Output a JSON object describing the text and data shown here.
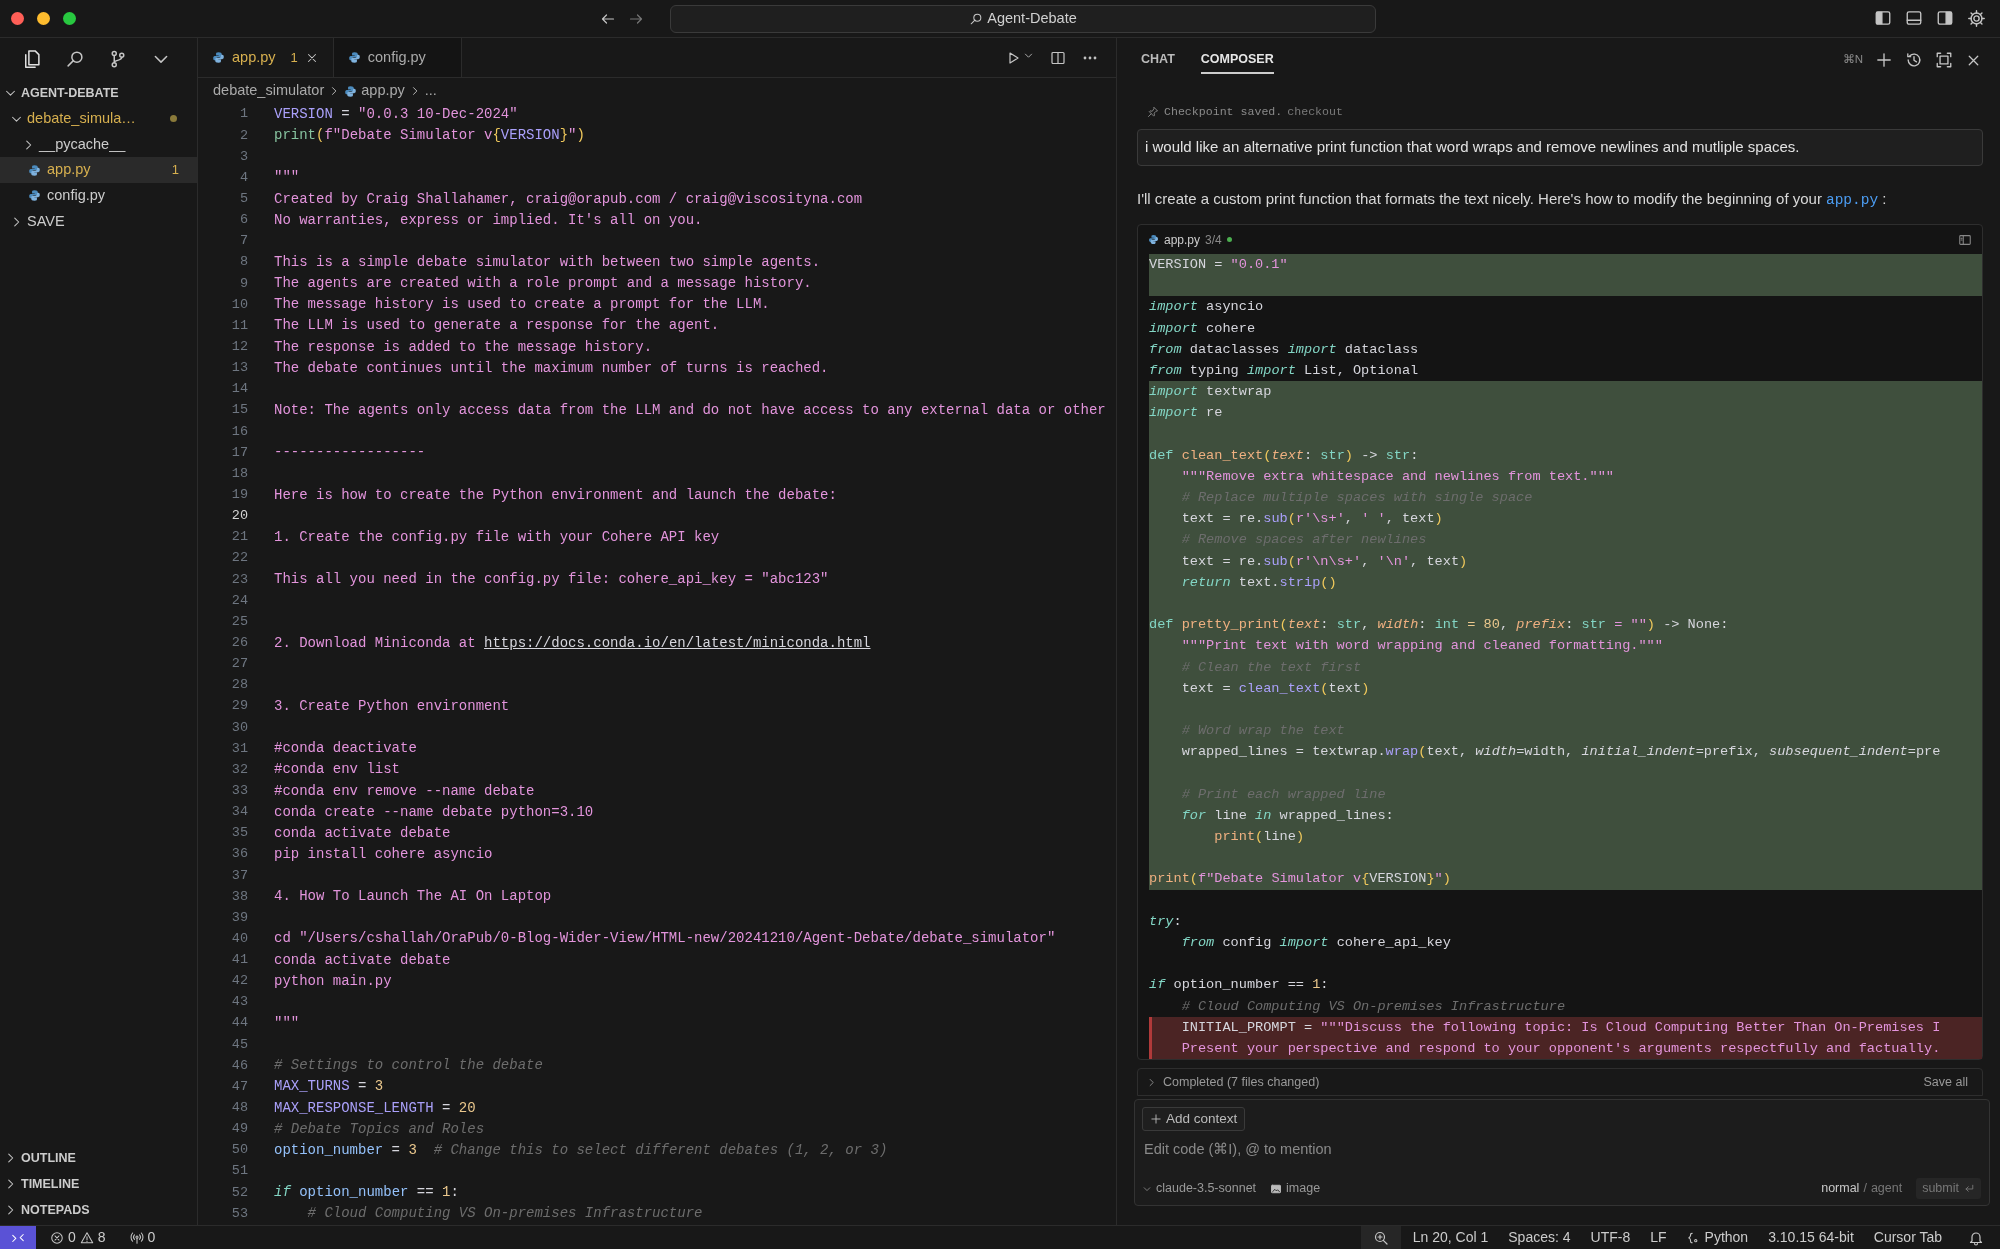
{
  "window": {
    "title": "Agent-Debate"
  },
  "explorer": {
    "title": "AGENT-DEBATE",
    "expanded": true,
    "items": [
      {
        "label": "debate_simula…",
        "kind": "folder",
        "expanded": true,
        "modified": true,
        "selected": false,
        "children": [
          {
            "label": "__pycache__",
            "kind": "folder",
            "expanded": false,
            "modified": false,
            "selected": false
          },
          {
            "label": "app.py",
            "kind": "file",
            "modified": false,
            "selected": true,
            "badge": "1"
          },
          {
            "label": "config.py",
            "kind": "file",
            "modified": false,
            "selected": false
          }
        ]
      },
      {
        "label": "SAVE",
        "kind": "folder",
        "expanded": false,
        "modified": false,
        "selected": false
      }
    ]
  },
  "panels": [
    {
      "label": "OUTLINE",
      "expanded": false
    },
    {
      "label": "TIMELINE",
      "expanded": false
    },
    {
      "label": "NOTEPADS",
      "expanded": false
    }
  ],
  "editor": {
    "tabs": [
      {
        "label": "app.py",
        "badge": "1",
        "selected": true
      },
      {
        "label": "config.py",
        "selected": false
      }
    ],
    "breadcrumb": [
      "debate_simulator",
      "app.py",
      "..."
    ],
    "lines": [
      {
        "n": "1",
        "current": false,
        "tokens": [
          {
            "kind": "variable",
            "text": "VERSION"
          },
          {
            "kind": "plain",
            "text": " = "
          },
          {
            "kind": "string",
            "text": "\"0.0.3 10-Dec-2024\""
          }
        ]
      },
      {
        "n": "2",
        "current": false,
        "tokens": [
          {
            "kind": "call",
            "text": "print"
          },
          {
            "kind": "bracket",
            "text": "("
          },
          {
            "kind": "string",
            "text": "f\"Debate Simulator v"
          },
          {
            "kind": "bracket",
            "text": "{"
          },
          {
            "kind": "variable",
            "text": "VERSION"
          },
          {
            "kind": "bracket",
            "text": "}"
          },
          {
            "kind": "string",
            "text": "\""
          },
          {
            "kind": "bracket",
            "text": ")"
          }
        ]
      },
      {
        "n": "3",
        "current": false
      },
      {
        "n": "4",
        "current": false,
        "tokens": [
          {
            "kind": "string",
            "text": "\"\"\""
          }
        ]
      },
      {
        "n": "5",
        "current": false,
        "tokens": [
          {
            "kind": "string",
            "text": "Created by Craig Shallahamer, craig@orapub.com / craig@viscosityna.com"
          }
        ]
      },
      {
        "n": "6",
        "current": false,
        "tokens": [
          {
            "kind": "string",
            "text": "No warranties, express or implied. It's all on you."
          }
        ]
      },
      {
        "n": "7",
        "current": false
      },
      {
        "n": "8",
        "current": false,
        "tokens": [
          {
            "kind": "string",
            "text": "This is a simple debate simulator with between two simple agents."
          }
        ]
      },
      {
        "n": "9",
        "current": false,
        "tokens": [
          {
            "kind": "string",
            "text": "The agents are created with a role prompt and a message history."
          }
        ]
      },
      {
        "n": "10",
        "current": false,
        "tokens": [
          {
            "kind": "string",
            "text": "The message history is used to create a prompt for the LLM."
          }
        ]
      },
      {
        "n": "11",
        "current": false,
        "tokens": [
          {
            "kind": "string",
            "text": "The LLM is used to generate a response for the agent."
          }
        ]
      },
      {
        "n": "12",
        "current": false,
        "tokens": [
          {
            "kind": "string",
            "text": "The response is added to the message history."
          }
        ]
      },
      {
        "n": "13",
        "current": false,
        "tokens": [
          {
            "kind": "string",
            "text": "The debate continues until the maximum number of turns is reached."
          }
        ]
      },
      {
        "n": "14",
        "current": false
      },
      {
        "n": "15",
        "current": false,
        "tokens": [
          {
            "kind": "string",
            "text": "Note: The agents only access data from the LLM and do not have access to any external data or other"
          }
        ]
      },
      {
        "n": "16",
        "current": false
      },
      {
        "n": "17",
        "current": false,
        "tokens": [
          {
            "kind": "string",
            "text": "------------------"
          }
        ]
      },
      {
        "n": "18",
        "current": false
      },
      {
        "n": "19",
        "current": false,
        "tokens": [
          {
            "kind": "string",
            "text": "Here is how to create the Python environment and launch the debate:"
          }
        ]
      },
      {
        "n": "20",
        "current": true
      },
      {
        "n": "21",
        "current": false,
        "tokens": [
          {
            "kind": "string",
            "text": "1. Create the config.py file with your Cohere API key"
          }
        ]
      },
      {
        "n": "22",
        "current": false
      },
      {
        "n": "23",
        "current": false,
        "tokens": [
          {
            "kind": "string",
            "text": "This all you need in the config.py file: cohere_api_key = \"abc123\""
          }
        ]
      },
      {
        "n": "24",
        "current": false
      },
      {
        "n": "25",
        "current": false
      },
      {
        "n": "26",
        "current": false,
        "tokens": [
          {
            "kind": "string",
            "text": "2. Download Miniconda at "
          },
          {
            "kind": "link",
            "text": "https://docs.conda.io/en/latest/miniconda.html"
          }
        ]
      },
      {
        "n": "27",
        "current": false
      },
      {
        "n": "28",
        "current": false
      },
      {
        "n": "29",
        "current": false,
        "tokens": [
          {
            "kind": "string",
            "text": "3. Create Python environment"
          }
        ]
      },
      {
        "n": "30",
        "current": false
      },
      {
        "n": "31",
        "current": false,
        "tokens": [
          {
            "kind": "string",
            "text": "#conda deactivate"
          }
        ]
      },
      {
        "n": "32",
        "current": false,
        "tokens": [
          {
            "kind": "string",
            "text": "#conda env list"
          }
        ]
      },
      {
        "n": "33",
        "current": false,
        "tokens": [
          {
            "kind": "string",
            "text": "#conda env remove --name debate"
          }
        ]
      },
      {
        "n": "34",
        "current": false,
        "tokens": [
          {
            "kind": "string",
            "text": "conda create --name debate python=3.10"
          }
        ]
      },
      {
        "n": "35",
        "current": false,
        "tokens": [
          {
            "kind": "string",
            "text": "conda activate debate"
          }
        ]
      },
      {
        "n": "36",
        "current": false,
        "tokens": [
          {
            "kind": "string",
            "text": "pip install cohere asyncio"
          }
        ]
      },
      {
        "n": "37",
        "current": false
      },
      {
        "n": "38",
        "current": false,
        "tokens": [
          {
            "kind": "string",
            "text": "4. How To Launch The AI On Laptop"
          }
        ]
      },
      {
        "n": "39",
        "current": false
      },
      {
        "n": "40",
        "current": false,
        "tokens": [
          {
            "kind": "string",
            "text": "cd \"/Users/cshallah/OraPub/0-Blog-Wider-View/HTML-new/20241210/Agent-Debate/debate_simulator\""
          }
        ]
      },
      {
        "n": "41",
        "current": false,
        "tokens": [
          {
            "kind": "string",
            "text": "conda activate debate"
          }
        ]
      },
      {
        "n": "42",
        "current": false,
        "tokens": [
          {
            "kind": "string",
            "text": "python main.py"
          }
        ]
      },
      {
        "n": "43",
        "current": false
      },
      {
        "n": "44",
        "current": false,
        "tokens": [
          {
            "kind": "string",
            "text": "\"\"\""
          }
        ]
      },
      {
        "n": "45",
        "current": false
      },
      {
        "n": "46",
        "current": false,
        "tokens": [
          {
            "kind": "comment",
            "text": "# Settings to control the debate"
          }
        ]
      },
      {
        "n": "47",
        "current": false,
        "tokens": [
          {
            "kind": "variable",
            "text": "MAX_TURNS"
          },
          {
            "kind": "plain",
            "text": " = "
          },
          {
            "kind": "number",
            "text": "3"
          }
        ]
      },
      {
        "n": "48",
        "current": false,
        "tokens": [
          {
            "kind": "variable",
            "text": "MAX_RESPONSE_LENGTH"
          },
          {
            "kind": "plain",
            "text": " = "
          },
          {
            "kind": "number",
            "text": "20"
          }
        ]
      },
      {
        "n": "49",
        "current": false,
        "tokens": [
          {
            "kind": "comment",
            "text": "# Debate Topics and Roles"
          }
        ]
      },
      {
        "n": "50",
        "current": false,
        "tokens": [
          {
            "kind": "identifier",
            "text": "option_number"
          },
          {
            "kind": "plain",
            "text": " = "
          },
          {
            "kind": "number",
            "text": "3"
          },
          {
            "kind": "comment",
            "text": "  # Change this to select different debates (1, 2, or 3)"
          }
        ]
      },
      {
        "n": "51",
        "current": false
      },
      {
        "n": "52",
        "current": false,
        "tokens": [
          {
            "kind": "keyword",
            "text": "if"
          },
          {
            "kind": "identifier",
            "text": " option_number"
          },
          {
            "kind": "plain",
            "text": " == "
          },
          {
            "kind": "number",
            "text": "1"
          },
          {
            "kind": "plain",
            "text": ":"
          }
        ]
      },
      {
        "n": "53",
        "current": false,
        "tokens": [
          {
            "kind": "comment",
            "text": "    # Cloud Computing VS On-premises Infrastructure"
          }
        ]
      }
    ]
  },
  "composer": {
    "tabs": [
      {
        "label": "CHAT",
        "selected": false
      },
      {
        "label": "COMPOSER",
        "selected": true
      }
    ],
    "shortcut": "⌘N",
    "checkpoint": {
      "label": "Checkpoint saved.",
      "action": "checkout"
    },
    "user_message": "i would like an alternative print function that word wraps and remove newlines and mutliple spaces.",
    "reply": {
      "text": "I'll create a custom print function that formats the text nicely. Here's how to modify the beginning of your",
      "file_link": "app.py",
      "after": ":"
    },
    "code_block": {
      "file": "app.py",
      "progress": "3/4",
      "lines": [
        {
          "kind": "added",
          "tokens": [
            {
              "kind": "plain",
              "text": "VERSION = "
            },
            {
              "kind": "string",
              "text": "\"0.0.1\""
            }
          ]
        },
        {
          "kind": "added"
        },
        {
          "kind": "plain",
          "tokens": [
            {
              "kind": "keyword",
              "text": "import"
            },
            {
              "kind": "plain",
              "text": " asyncio"
            }
          ]
        },
        {
          "kind": "plain",
          "tokens": [
            {
              "kind": "keyword",
              "text": "import"
            },
            {
              "kind": "plain",
              "text": " cohere"
            }
          ]
        },
        {
          "kind": "plain",
          "tokens": [
            {
              "kind": "keyword",
              "text": "from"
            },
            {
              "kind": "plain",
              "text": " dataclasses "
            },
            {
              "kind": "keyword",
              "text": "import"
            },
            {
              "kind": "plain",
              "text": " dataclass"
            }
          ]
        },
        {
          "kind": "plain",
          "tokens": [
            {
              "kind": "keyword",
              "text": "from"
            },
            {
              "kind": "plain",
              "text": " typing "
            },
            {
              "kind": "keyword",
              "text": "import"
            },
            {
              "kind": "plain",
              "text": " List, Optional"
            }
          ]
        },
        {
          "kind": "added",
          "tokens": [
            {
              "kind": "keyword",
              "text": "import"
            },
            {
              "kind": "plain",
              "text": " textwrap"
            }
          ]
        },
        {
          "kind": "added",
          "tokens": [
            {
              "kind": "keyword",
              "text": "import"
            },
            {
              "kind": "plain",
              "text": " re"
            }
          ]
        },
        {
          "kind": "added"
        },
        {
          "kind": "added",
          "tokens": [
            {
              "kind": "builtin",
              "text": "def"
            },
            {
              "kind": "function",
              "text": " clean_text"
            },
            {
              "kind": "bracket",
              "text": "("
            },
            {
              "kind": "parameter",
              "text": "text"
            },
            {
              "kind": "plain",
              "text": ": "
            },
            {
              "kind": "builtin",
              "text": "str"
            },
            {
              "kind": "bracket",
              "text": ")"
            },
            {
              "kind": "plain",
              "text": " -> "
            },
            {
              "kind": "builtin",
              "text": "str"
            },
            {
              "kind": "plain",
              "text": ":"
            }
          ]
        },
        {
          "kind": "added",
          "tokens": [
            {
              "kind": "string",
              "text": "    \"\"\"Remove extra whitespace and newlines from text.\"\"\""
            }
          ]
        },
        {
          "kind": "added",
          "tokens": [
            {
              "kind": "comment",
              "text": "    # Replace multiple spaces with single space"
            }
          ]
        },
        {
          "kind": "added",
          "tokens": [
            {
              "kind": "plain",
              "text": "    text = re."
            },
            {
              "kind": "method",
              "text": "sub"
            },
            {
              "kind": "bracket",
              "text": "("
            },
            {
              "kind": "string",
              "text": "r'\\s+'"
            },
            {
              "kind": "plain",
              "text": ", "
            },
            {
              "kind": "string",
              "text": "' '"
            },
            {
              "kind": "plain",
              "text": ", text"
            },
            {
              "kind": "bracket",
              "text": ")"
            }
          ]
        },
        {
          "kind": "added",
          "tokens": [
            {
              "kind": "comment",
              "text": "    # Remove spaces after newlines"
            }
          ]
        },
        {
          "kind": "added",
          "tokens": [
            {
              "kind": "plain",
              "text": "    text = re."
            },
            {
              "kind": "method",
              "text": "sub"
            },
            {
              "kind": "bracket",
              "text": "("
            },
            {
              "kind": "string",
              "text": "r'\\n\\s+'"
            },
            {
              "kind": "plain",
              "text": ", "
            },
            {
              "kind": "string",
              "text": "'\\n'"
            },
            {
              "kind": "plain",
              "text": ", text"
            },
            {
              "kind": "bracket",
              "text": ")"
            }
          ]
        },
        {
          "kind": "added",
          "tokens": [
            {
              "kind": "keyword",
              "text": "    return"
            },
            {
              "kind": "plain",
              "text": " text."
            },
            {
              "kind": "method",
              "text": "strip"
            },
            {
              "kind": "bracket",
              "text": "()"
            }
          ]
        },
        {
          "kind": "added"
        },
        {
          "kind": "added",
          "tokens": [
            {
              "kind": "builtin",
              "text": "def"
            },
            {
              "kind": "function",
              "text": " pretty_print"
            },
            {
              "kind": "bracket",
              "text": "("
            },
            {
              "kind": "parameter",
              "text": "text"
            },
            {
              "kind": "plain",
              "text": ": "
            },
            {
              "kind": "builtin",
              "text": "str"
            },
            {
              "kind": "plain",
              "text": ", "
            },
            {
              "kind": "parameter",
              "text": "width"
            },
            {
              "kind": "plain",
              "text": ": "
            },
            {
              "kind": "builtin",
              "text": "int"
            },
            {
              "kind": "number",
              "text": " = 80"
            },
            {
              "kind": "plain",
              "text": ", "
            },
            {
              "kind": "parameter",
              "text": "prefix"
            },
            {
              "kind": "plain",
              "text": ": "
            },
            {
              "kind": "builtin",
              "text": "str"
            },
            {
              "kind": "string",
              "text": " = \"\""
            },
            {
              "kind": "bracket",
              "text": ")"
            },
            {
              "kind": "plain",
              "text": " -> None:"
            }
          ]
        },
        {
          "kind": "added",
          "tokens": [
            {
              "kind": "string",
              "text": "    \"\"\"Print text with word wrapping and cleaned formatting.\"\"\""
            }
          ]
        },
        {
          "kind": "added",
          "tokens": [
            {
              "kind": "comment",
              "text": "    # Clean the text first"
            }
          ]
        },
        {
          "kind": "added",
          "tokens": [
            {
              "kind": "plain",
              "text": "    text = "
            },
            {
              "kind": "method",
              "text": "clean_text"
            },
            {
              "kind": "bracket",
              "text": "("
            },
            {
              "kind": "plain",
              "text": "text"
            },
            {
              "kind": "bracket",
              "text": ")"
            }
          ]
        },
        {
          "kind": "added"
        },
        {
          "kind": "added",
          "tokens": [
            {
              "kind": "comment",
              "text": "    # Word wrap the text"
            }
          ]
        },
        {
          "kind": "added",
          "tokens": [
            {
              "kind": "plain",
              "text": "    wrapped_lines = textwrap."
            },
            {
              "kind": "method",
              "text": "wrap"
            },
            {
              "kind": "bracket",
              "text": "("
            },
            {
              "kind": "plain",
              "text": "text, "
            },
            {
              "kind": "argument",
              "text": "width"
            },
            {
              "kind": "plain",
              "text": "=width, "
            },
            {
              "kind": "argument",
              "text": "initial_indent"
            },
            {
              "kind": "plain",
              "text": "=prefix, "
            },
            {
              "kind": "argument",
              "text": "subsequent_indent"
            },
            {
              "kind": "plain",
              "text": "=pre"
            }
          ]
        },
        {
          "kind": "added"
        },
        {
          "kind": "added",
          "tokens": [
            {
              "kind": "comment",
              "text": "    # Print each wrapped line"
            }
          ]
        },
        {
          "kind": "added",
          "tokens": [
            {
              "kind": "keyword",
              "text": "    for"
            },
            {
              "kind": "plain",
              "text": " line "
            },
            {
              "kind": "keyword",
              "text": "in"
            },
            {
              "kind": "plain",
              "text": " wrapped_lines:"
            }
          ]
        },
        {
          "kind": "added",
          "tokens": [
            {
              "kind": "function",
              "text": "        print"
            },
            {
              "kind": "bracket",
              "text": "("
            },
            {
              "kind": "plain",
              "text": "line"
            },
            {
              "kind": "bracket",
              "text": ")"
            }
          ]
        },
        {
          "kind": "added"
        },
        {
          "kind": "added",
          "tokens": [
            {
              "kind": "function",
              "text": "print"
            },
            {
              "kind": "bracket",
              "text": "("
            },
            {
              "kind": "string",
              "text": "f\"Debate Simulator v"
            },
            {
              "kind": "bracket",
              "text": "{"
            },
            {
              "kind": "plain",
              "text": "VERSION"
            },
            {
              "kind": "bracket",
              "text": "}"
            },
            {
              "kind": "string",
              "text": "\""
            },
            {
              "kind": "bracket",
              "text": ")"
            }
          ]
        },
        {
          "kind": "plain"
        },
        {
          "kind": "plain",
          "tokens": [
            {
              "kind": "keyword",
              "text": "try"
            },
            {
              "kind": "plain",
              "text": ":"
            }
          ]
        },
        {
          "kind": "plain",
          "tokens": [
            {
              "kind": "keyword",
              "text": "    from"
            },
            {
              "kind": "plain",
              "text": " config "
            },
            {
              "kind": "keyword",
              "text": "import"
            },
            {
              "kind": "plain",
              "text": " cohere_api_key"
            }
          ]
        },
        {
          "kind": "plain"
        },
        {
          "kind": "plain",
          "tokens": [
            {
              "kind": "keyword",
              "text": "if"
            },
            {
              "kind": "plain",
              "text": " option_number == "
            },
            {
              "kind": "number",
              "text": "1"
            },
            {
              "kind": "plain",
              "text": ":"
            }
          ]
        },
        {
          "kind": "plain",
          "tokens": [
            {
              "kind": "comment",
              "text": "    # Cloud Computing VS On-premises Infrastructure"
            }
          ]
        },
        {
          "kind": "removed",
          "tokens": [
            {
              "kind": "plain",
              "text": "    INITIAL_PROMPT = "
            },
            {
              "kind": "string",
              "text": "\"\"\"Discuss the following topic: Is Cloud Computing Better Than On-Premises I"
            }
          ]
        },
        {
          "kind": "removed",
          "tokens": [
            {
              "kind": "string",
              "text": "    Present your perspective and respond to your opponent's arguments respectfully and factually."
            }
          ]
        }
      ]
    },
    "summary": {
      "label": "Completed (7 files changed)",
      "action": "Save all"
    },
    "input": {
      "context_button": "Add context",
      "placeholder": "Edit code (⌘I), @ to mention",
      "model": "claude-3.5-sonnet",
      "attach": "image",
      "modes": [
        {
          "label": "normal",
          "selected": true
        },
        {
          "label": "agent",
          "selected": false
        }
      ],
      "separator": "/",
      "submit": "submit"
    }
  },
  "status_bar": {
    "errors": "0",
    "warnings": "8",
    "ports": "0",
    "items": [
      {
        "label": "Ln 20, Col 1",
        "kind": "text"
      },
      {
        "label": "Spaces: 4",
        "kind": "text"
      },
      {
        "label": "UTF-8",
        "kind": "text"
      },
      {
        "label": "LF",
        "kind": "text"
      },
      {
        "label": "Python",
        "kind": "language"
      },
      {
        "label": "3.10.15 64-bit",
        "kind": "text"
      },
      {
        "label": "Cursor Tab",
        "kind": "text"
      }
    ]
  }
}
